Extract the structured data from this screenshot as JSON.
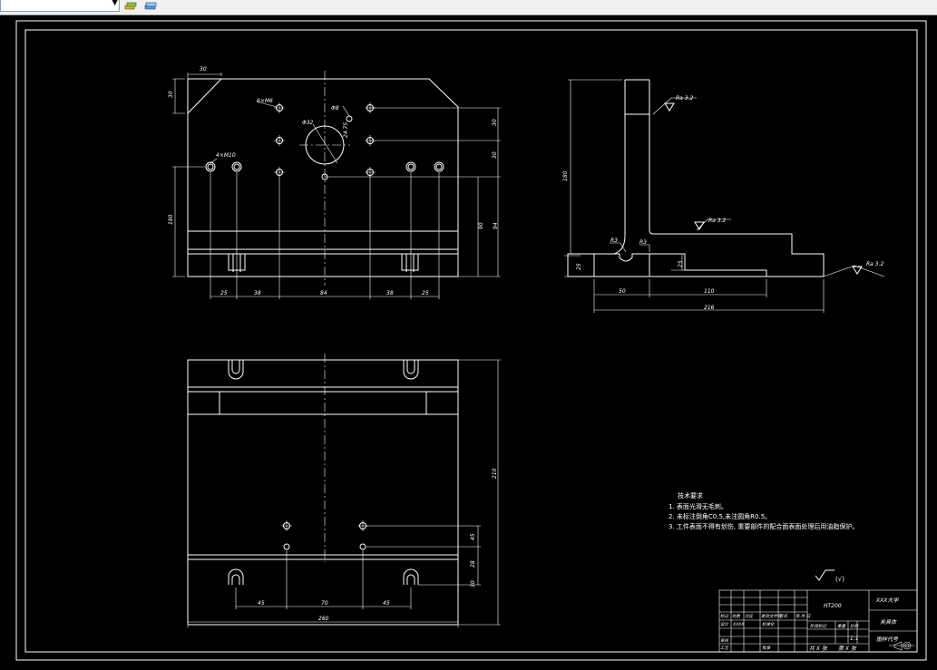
{
  "app": {
    "toolbar": {
      "layer_combo_value": "",
      "icons": [
        "layer-state-icon",
        "layer-properties-icon"
      ]
    }
  },
  "drawing": {
    "colors": {
      "background": "#000000",
      "lines": "#ffffff"
    },
    "top_view": {
      "dims_top": [
        "30",
        "30"
      ],
      "hole_labels": [
        "6×M6",
        "Φ8",
        "Φ32",
        "4×M10"
      ],
      "dims_right": [
        "30",
        "30",
        "90",
        "94",
        "24.75"
      ],
      "dim_left": "180",
      "dims_bottom": [
        "25",
        "38",
        "84",
        "38",
        "25"
      ]
    },
    "side_view": {
      "roughness": [
        "Ra 3.2",
        "Ra 3.2",
        "Ra 3.2"
      ],
      "radius": [
        "R3",
        "R3"
      ],
      "dim_height": "180",
      "dims_left": [
        "25",
        "25"
      ],
      "dims_bottom": [
        "50",
        "110"
      ],
      "dim_total": "216"
    },
    "bottom_view": {
      "dims_right": [
        "210",
        "45",
        "28",
        "30"
      ],
      "dims_bottom": [
        "45",
        "70",
        "45"
      ],
      "dim_width": "260"
    },
    "tech_requirements": {
      "title": "技术要求",
      "items": [
        "1. 表面光滑无毛刺。",
        "2. 未标注倒角C0.5,未注圆角R0.5。",
        "3. 工件表面不得有划伤, 重要部件的配合面表面处理后用油脂保护。"
      ]
    },
    "general_roughness": "(√)",
    "title_block": {
      "material": "HT200",
      "school": "XXX大学",
      "part_name": "夹具体",
      "drawing_no": "图样代号",
      "scale": "1:1",
      "sheet_total": "共 X 张",
      "sheet_no": "第 X 张",
      "cells": [
        "标记",
        "处数",
        "分区",
        "更改文件号",
        "签名",
        "年.月.日",
        "设计",
        "XXXX",
        "标准化",
        "阶段标记",
        "重量",
        "比例",
        "审核",
        "工艺",
        "批准"
      ]
    }
  }
}
